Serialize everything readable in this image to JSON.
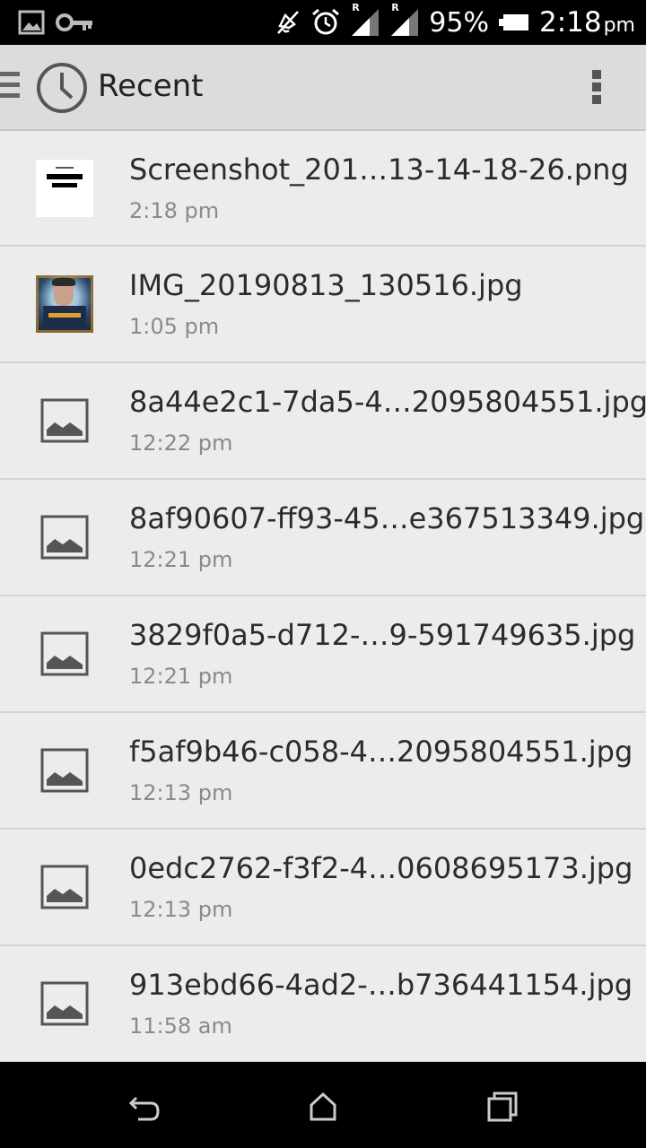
{
  "status_bar": {
    "battery_percent": "95%",
    "time": "2:18",
    "ampm": "pm",
    "signal_labels": [
      "R",
      "R"
    ],
    "icons": [
      "image-icon",
      "key-icon",
      "mute-icon",
      "alarm-icon",
      "signal-icon",
      "signal-icon",
      "battery-icon"
    ]
  },
  "action_bar": {
    "title": "Recent",
    "icons": [
      "menu-icon",
      "clock-icon",
      "overflow-menu-icon"
    ]
  },
  "files": [
    {
      "name": "Screenshot_201…13-14-18-26.png",
      "time": "2:18 pm",
      "thumb": "screenshot"
    },
    {
      "name": "IMG_20190813_130516.jpg",
      "time": "1:05 pm",
      "thumb": "photo"
    },
    {
      "name": "8a44e2c1-7da5-4…2095804551.jpg",
      "time": "12:22 pm",
      "thumb": "image-icon"
    },
    {
      "name": "8af90607-ff93-45…e367513349.jpg",
      "time": "12:21 pm",
      "thumb": "image-icon"
    },
    {
      "name": "3829f0a5-d712-…9-591749635.jpg",
      "time": "12:21 pm",
      "thumb": "image-icon"
    },
    {
      "name": "f5af9b46-c058-4…2095804551.jpg",
      "time": "12:13 pm",
      "thumb": "image-icon"
    },
    {
      "name": "0edc2762-f3f2-4…0608695173.jpg",
      "time": "12:13 pm",
      "thumb": "image-icon"
    },
    {
      "name": "913ebd66-4ad2-…b736441154.jpg",
      "time": "11:58 am",
      "thumb": "image-icon"
    }
  ],
  "nav_bar": {
    "icons": [
      "back-icon",
      "home-icon",
      "recents-icon"
    ]
  },
  "colors": {
    "list_background": "#ececec",
    "action_bar": "#dcdcdc",
    "primary_text": "#2b2b2b",
    "secondary_text": "#8a8a8a"
  }
}
